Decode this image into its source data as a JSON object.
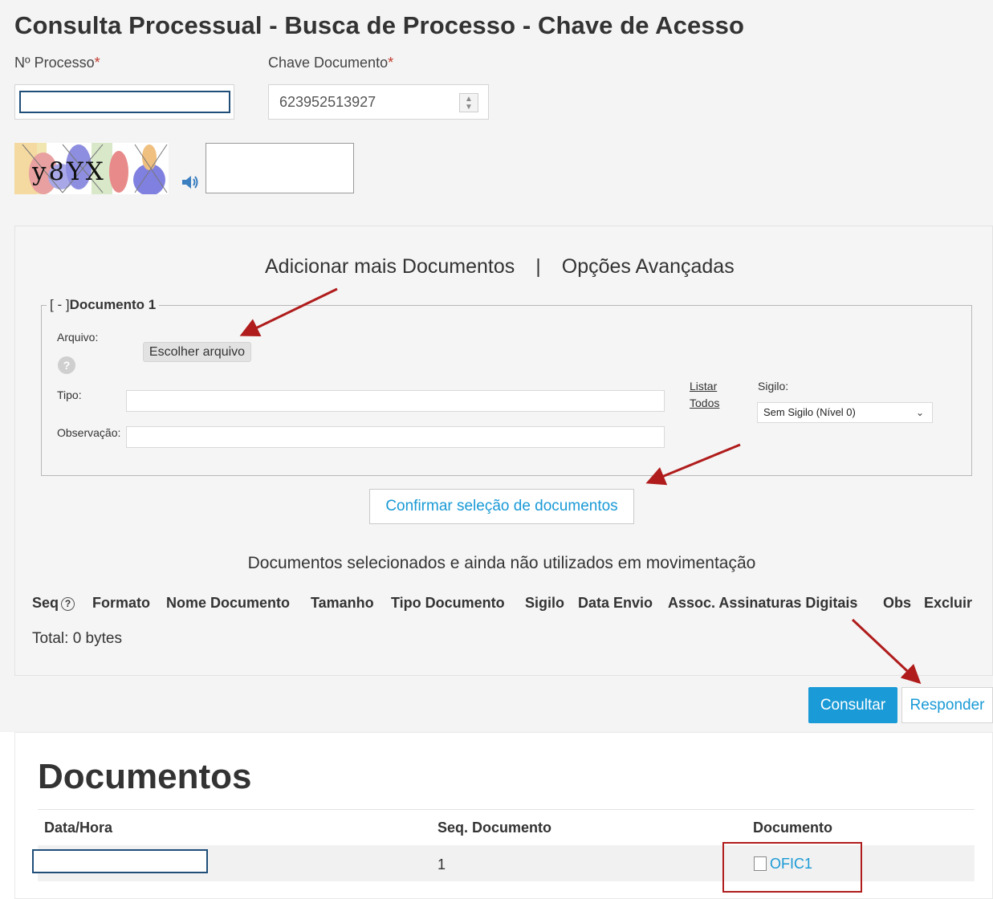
{
  "title": "Consulta Processual - Busca de Processo - Chave de Acesso",
  "form": {
    "processo_label": "Nº Processo",
    "chave_label": "Chave Documento",
    "required_mark": "*",
    "chave_value": "623952513927",
    "captcha_text": "y8YX"
  },
  "panel": {
    "link_add": "Adicionar mais Documentos",
    "separator": "|",
    "link_advanced": "Opções Avançadas",
    "fieldset": {
      "legend_toggle": "[ - ]",
      "legend_title": "Documento 1",
      "arquivo_label": "Arquivo:",
      "file_button": "Escolher arquivo",
      "help_glyph": "?",
      "tipo_label": "Tipo:",
      "obs_label": "Observação:",
      "listar_1": "Listar",
      "listar_2": "Todos",
      "sigilo_label": "Sigilo:",
      "sigilo_value": "Sem Sigilo (Nível 0)"
    },
    "confirm_button": "Confirmar seleção de documentos",
    "selected_heading": "Documentos selecionados e ainda não utilizados em movimentação",
    "columns": {
      "seq": "Seq",
      "seq_help": "?",
      "formato": "Formato",
      "nome": "Nome Documento",
      "tamanho": "Tamanho",
      "tipo": "Tipo Documento",
      "sigilo": "Sigilo",
      "data_envio": "Data Envio",
      "assoc": "Assoc. Assinaturas Digitais",
      "obs": "Obs",
      "excluir": "Excluir"
    },
    "total": "Total: 0 bytes"
  },
  "actions": {
    "consultar": "Consultar",
    "responder": "Responder"
  },
  "documentos": {
    "title": "Documentos",
    "headers": {
      "data_hora": "Data/Hora",
      "seq": "Seq. Documento",
      "documento": "Documento"
    },
    "rows": [
      {
        "seq": "1",
        "documento": "OFIC1"
      }
    ]
  },
  "colors": {
    "primary": "#1a9ad6",
    "annotation_red": "#b01c1c",
    "focus_border": "#1f4e79"
  }
}
